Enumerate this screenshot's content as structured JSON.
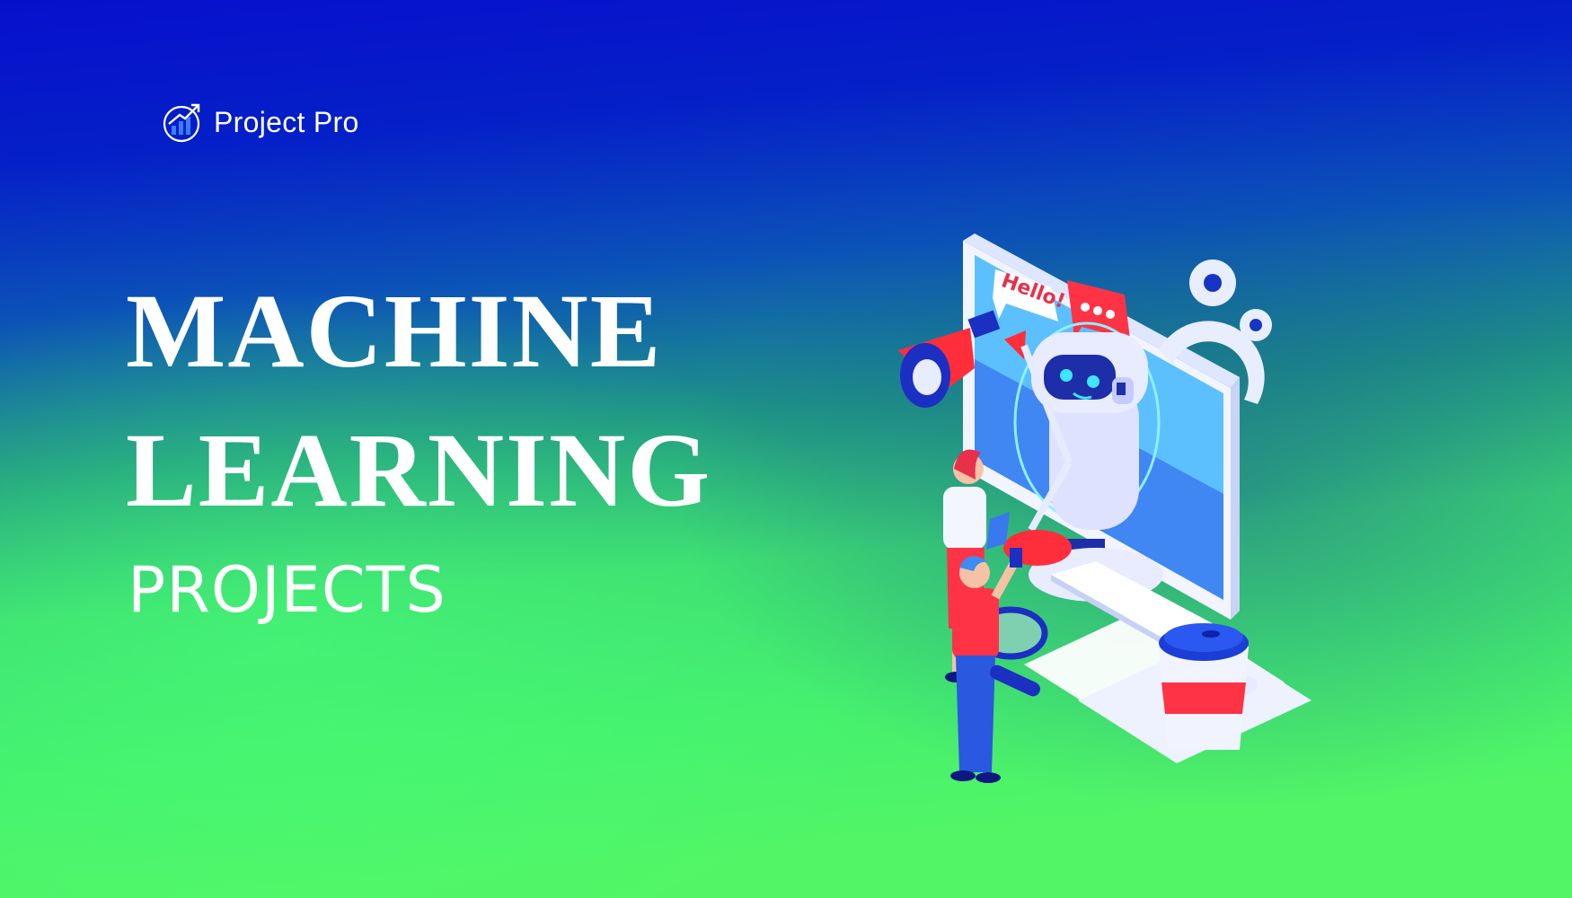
{
  "brand": {
    "name": "Project Pro",
    "logo_icon": "rising-bar-chart-logo-icon"
  },
  "headline": {
    "line1": "MACHINE",
    "line2": "LEARNING",
    "subline": "PROJECTS"
  },
  "illustration": {
    "speech_bubble_text": "Hello!",
    "chat_bubble_icon": "chat-dots-icon"
  },
  "colors": {
    "top": "#0610c8",
    "bottom": "#3ff56a",
    "text": "#ffffff",
    "accent_red": "#ff3346"
  }
}
